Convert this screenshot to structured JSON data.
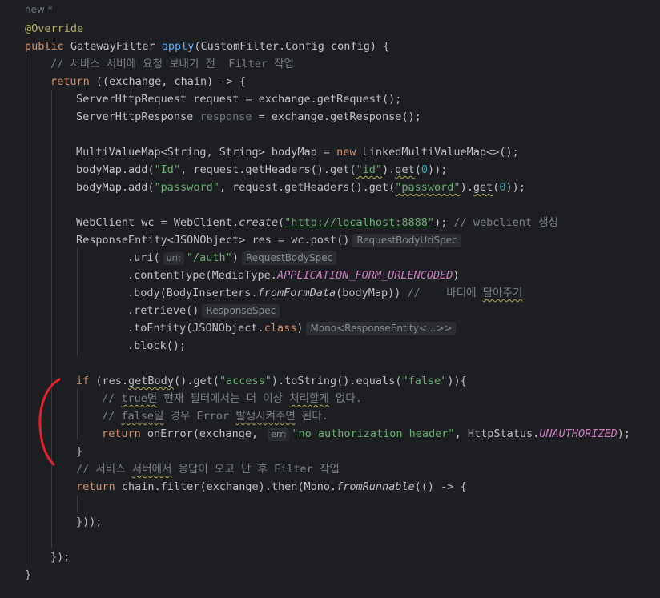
{
  "editor": {
    "file_status": "new *",
    "colors": {
      "background": "#1e1f22",
      "keyword": "#cf8e6d",
      "function": "#56a8f5",
      "string": "#6aab73",
      "comment": "#7a7e85",
      "annotation": "#b3ae60",
      "constant": "#c77dbb",
      "number": "#2aacb8",
      "red_mark": "#e5202a"
    },
    "annotation_mark": "red-bracket-icon",
    "lines": [
      {
        "annotation": "@Override"
      },
      {
        "kw": "public",
        "type": "GatewayFilter",
        "fn": "apply",
        "params": "(CustomFilter.Config config) {"
      },
      {
        "comment": "// 서비스 서버에 요청 보내기 전  Filter 작업"
      },
      {
        "kw": "return",
        "rest": "((exchange, chain) -> {"
      },
      {
        "text": "ServerHttpRequest request = exchange.getRequest();"
      },
      {
        "a": "ServerHttpResponse ",
        "dim": "response",
        "b": " = exchange.getResponse();"
      },
      {
        "a": "MultiValueMap<String, String> bodyMap = ",
        "kw": "new",
        "b": " LinkedMultiValueMap<>();"
      },
      {
        "a": "bodyMap.add(",
        "s1": "\"Id\"",
        "b": ", request.getHeaders().get(",
        "s2": "\"id\"",
        "c": ").",
        "m": "get",
        "d": "(",
        "n": "0",
        "e": "));"
      },
      {
        "a": "bodyMap.add(",
        "s1": "\"password\"",
        "b": ", request.getHeaders().get(",
        "s2": "\"password\"",
        "c": ").",
        "m": "get",
        "d": "(",
        "n": "0",
        "e": "));"
      },
      {
        "a": "WebClient wc = WebClient.",
        "i": "create",
        "b": "(",
        "s": "\"http://localhost:8888\"",
        "c": "); ",
        "com": "// webclient 생성"
      },
      {
        "a": "ResponseEntity<JSONObject> res = wc.post()",
        "hint": "RequestBodyUriSpec"
      },
      {
        "a": ".uri(",
        "ph": "uri:",
        "s": "\"/auth\"",
        "b": ")",
        "hint": "RequestBodySpec"
      },
      {
        "a": ".contentType(MediaType.",
        "const": "APPLICATION_FORM_URLENCODED",
        "b": ")"
      },
      {
        "a": ".body(BodyInserters.",
        "i": "fromFormData",
        "b": "(bodyMap)) ",
        "com1": "//    바디에 ",
        "comw": "담아주기"
      },
      {
        "a": ".retrieve()",
        "hint": "ResponseSpec"
      },
      {
        "a": ".toEntity(JSONObject.",
        "kw": "class",
        "b": ")",
        "hint": "Mono<ResponseEntity<...>>"
      },
      {
        "a": ".block();"
      },
      {
        "kw": "if",
        "a": " (res.",
        "w": "getBody",
        "b": "().get(",
        "s1": "\"access\"",
        "c": ").toString().equals(",
        "s2": "\"false\"",
        "d": ")){"
      },
      {
        "c1": "// ",
        "w1": "true면",
        "c2": " 현재 필터에서는 더 이상 ",
        "w2": "처리할게",
        "c3": " 없다."
      },
      {
        "c1": "// ",
        "w1": "false일",
        "c2": " 경우 Error ",
        "w2": "발생시켜주면",
        "c3": " 된다."
      },
      {
        "kw": "return",
        "a": " onError(exchange, ",
        "ph": "err:",
        "s": "\"no authorization header\"",
        "b": ", HttpStatus.",
        "const": "UNAUTHORIZED",
        "c": ");"
      },
      {
        "text": "}"
      },
      {
        "c1": "// 서비스 ",
        "w1": "서버에서",
        "c2": " 응답이 오고 난 후 Filter 작업"
      },
      {
        "kw": "return",
        "a": " chain.filter(exchange).then(Mono.",
        "i": "fromRunnable",
        "b": "(() -> {"
      },
      {
        "text": "}));"
      },
      {
        "text": "});"
      },
      {
        "text": "}"
      }
    ]
  }
}
